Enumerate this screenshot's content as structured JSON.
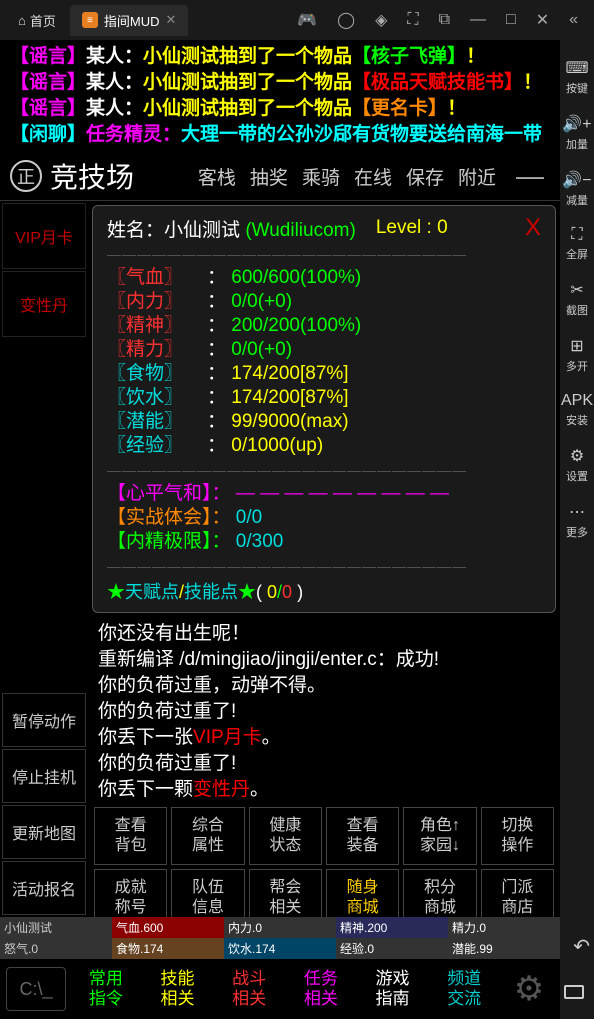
{
  "titlebar": {
    "home_label": "首页",
    "tab_label": "指间MUD",
    "icons": {
      "gamepad": "🎮",
      "user": "◯",
      "bell": "◈",
      "expand": "⛶",
      "copy": "⧉",
      "min": "—",
      "max": "□",
      "close": "✕",
      "collapse": "«"
    }
  },
  "rightbar": [
    {
      "icon": "⌨",
      "label": "按键"
    },
    {
      "icon": "🔊+",
      "label": "加量"
    },
    {
      "icon": "🔊−",
      "label": "减量"
    },
    {
      "icon": "⛶",
      "label": "全屏"
    },
    {
      "icon": "✂",
      "label": "截图"
    },
    {
      "icon": "⊞",
      "label": "多开"
    },
    {
      "icon": "APK",
      "label": "安装"
    },
    {
      "icon": "⚙",
      "label": "设置"
    },
    {
      "icon": "⋯",
      "label": "更多"
    }
  ],
  "chatlog": [
    {
      "tag": "【谣言】",
      "tag_cls": "bracket-pink",
      "who": "某人：",
      "msg": "小仙测试抽到了一个物品",
      "item": "【核子飞弹】",
      "item_cls": "txt-green",
      "end": "！"
    },
    {
      "tag": "【谣言】",
      "tag_cls": "bracket-pink",
      "who": "某人：",
      "msg": "小仙测试抽到了一个物品",
      "item": "【极品天赋技能书】",
      "item_cls": "txt-red",
      "end": "！"
    },
    {
      "tag": "【谣言】",
      "tag_cls": "bracket-pink",
      "who": "某人：",
      "msg": "小仙测试抽到了一个物品",
      "item": "【更名卡】",
      "item_cls": "txt-orange",
      "end": "！"
    },
    {
      "tag": "【闲聊】",
      "tag_cls": "bracket-cyan",
      "who": "任务精灵：",
      "who_cls": "txt-pink",
      "msg": "大理一带的公孙沙郈有货物要送给南海一带",
      "msg_cls": "txt-cyan"
    }
  ],
  "location": {
    "icon": "正",
    "name": "竞技场",
    "buttons": [
      "客栈",
      "抽奖",
      "乘骑",
      "在线",
      "保存",
      "附近"
    ],
    "minus": "—"
  },
  "leftpanel": {
    "top": [
      "VIP月卡",
      "变性丹"
    ],
    "bottom": [
      "暂停动作",
      "停止挂机",
      "更新地图",
      "活动报名"
    ],
    "bottom_cls": [
      "c-white",
      "c-red",
      "c-white",
      "c-white"
    ]
  },
  "stats": {
    "name_label": "姓名：",
    "name": "小仙测试",
    "id": "(Wudiliucom)",
    "level_label": "Level :",
    "level": "0",
    "close": "X",
    "rows": [
      {
        "lab": "〖气血〗",
        "lab_cls": "c-red",
        "val": "600/600(100%)",
        "val_cls": "c-green"
      },
      {
        "lab": "〖内力〗",
        "lab_cls": "c-red",
        "val": "0/0(+0)",
        "val_cls": "c-green"
      },
      {
        "lab": "〖精神〗",
        "lab_cls": "c-red",
        "val": "200/200(100%)",
        "val_cls": "c-green"
      },
      {
        "lab": "〖精力〗",
        "lab_cls": "c-red",
        "val": "0/0(+0)",
        "val_cls": "c-green"
      },
      {
        "lab": "〖食物〗",
        "lab_cls": "c-cyan",
        "val": "174/200[87%]",
        "val_cls": "c-yellow"
      },
      {
        "lab": "〖饮水〗",
        "lab_cls": "c-cyan",
        "val": "174/200[87%]",
        "val_cls": "c-yellow"
      },
      {
        "lab": "〖潜能〗",
        "lab_cls": "c-cyan",
        "val": "99/9000(max)",
        "val_cls": "c-yellow"
      },
      {
        "lab": "〖经验〗",
        "lab_cls": "c-cyan",
        "val": "0/1000(up)",
        "val_cls": "c-yellow"
      }
    ],
    "extra": [
      {
        "lab": "【心平气和】：",
        "lab_cls": "c-magenta",
        "val": "— — — — — — — — —",
        "val_cls": "c-magenta"
      },
      {
        "lab": "【实战体会】：",
        "lab_cls": "c-orange",
        "val": "0/0",
        "val_cls": "c-cyan"
      },
      {
        "lab": "【内精极限】：",
        "lab_cls": "c-green",
        "val": "0/300",
        "val_cls": "c-cyan"
      }
    ],
    "talent_pre": "★",
    "talent_l1": "天赋点",
    "talent_slash": "/",
    "talent_l2": "技能点",
    "talent_post": "★",
    "talent_paren": "( ",
    "talent_v1": "0",
    "talent_slash2": "/",
    "talent_v2": "0",
    "talent_close": " )"
  },
  "gamelog": [
    {
      "txt": "你还没有出生呢！",
      "cls": ""
    },
    {
      "txt": "重新编译 /d/mingjiao/jingji/enter.c：成功!",
      "cls": ""
    },
    {
      "txt": "你的负荷过重，动弹不得。",
      "cls": ""
    },
    {
      "txt": "你的负荷过重了!",
      "cls": ""
    },
    {
      "pre": "你丢下一张",
      "item": "VIP月卡",
      "item_cls": "txt-red",
      "post": "。"
    },
    {
      "txt": "你的负荷过重了!",
      "cls": ""
    },
    {
      "pre": "你丢下一颗",
      "item": "变性丹",
      "item_cls": "txt-red",
      "post": "。"
    }
  ],
  "actionbuttons": [
    {
      "l1": "查看",
      "l2": "背包"
    },
    {
      "l1": "综合",
      "l2": "属性"
    },
    {
      "l1": "健康",
      "l2": "状态"
    },
    {
      "l1": "查看",
      "l2": "装备"
    },
    {
      "l1": "角色↑",
      "l2": "家园↓"
    },
    {
      "l1": "切换",
      "l2": "操作"
    },
    {
      "l1": "成就",
      "l2": "称号"
    },
    {
      "l1": "队伍",
      "l2": "信息"
    },
    {
      "l1": "帮会",
      "l2": "相关"
    },
    {
      "l1": "随身",
      "l2": "商城",
      "cls": "yellow"
    },
    {
      "l1": "积分",
      "l2": "商城"
    },
    {
      "l1": "门派",
      "l2": "商店"
    }
  ],
  "statusbars": [
    [
      {
        "t": "小仙测试"
      },
      {
        "t": "气血.600"
      },
      {
        "t": "内力.0"
      },
      {
        "t": "精神.200"
      },
      {
        "t": "精力.0"
      }
    ],
    [
      {
        "t": "怒气.0"
      },
      {
        "t": "食物.174"
      },
      {
        "t": "饮水.174"
      },
      {
        "t": "经验.0"
      },
      {
        "t": "潜能.99"
      }
    ]
  ],
  "bottombar": [
    {
      "l1": "常用",
      "l2": "指令",
      "cls": "bb-green"
    },
    {
      "l1": "技能",
      "l2": "相关",
      "cls": "bb-yellow"
    },
    {
      "l1": "战斗",
      "l2": "相关",
      "cls": "bb-red"
    },
    {
      "l1": "任务",
      "l2": "相关",
      "cls": "bb-pink"
    },
    {
      "l1": "游戏",
      "l2": "指南",
      "cls": "bb-white"
    },
    {
      "l1": "频道",
      "l2": "交流",
      "cls": "bb-cyan"
    }
  ],
  "console": "C:\\_",
  "gear": "⚙"
}
